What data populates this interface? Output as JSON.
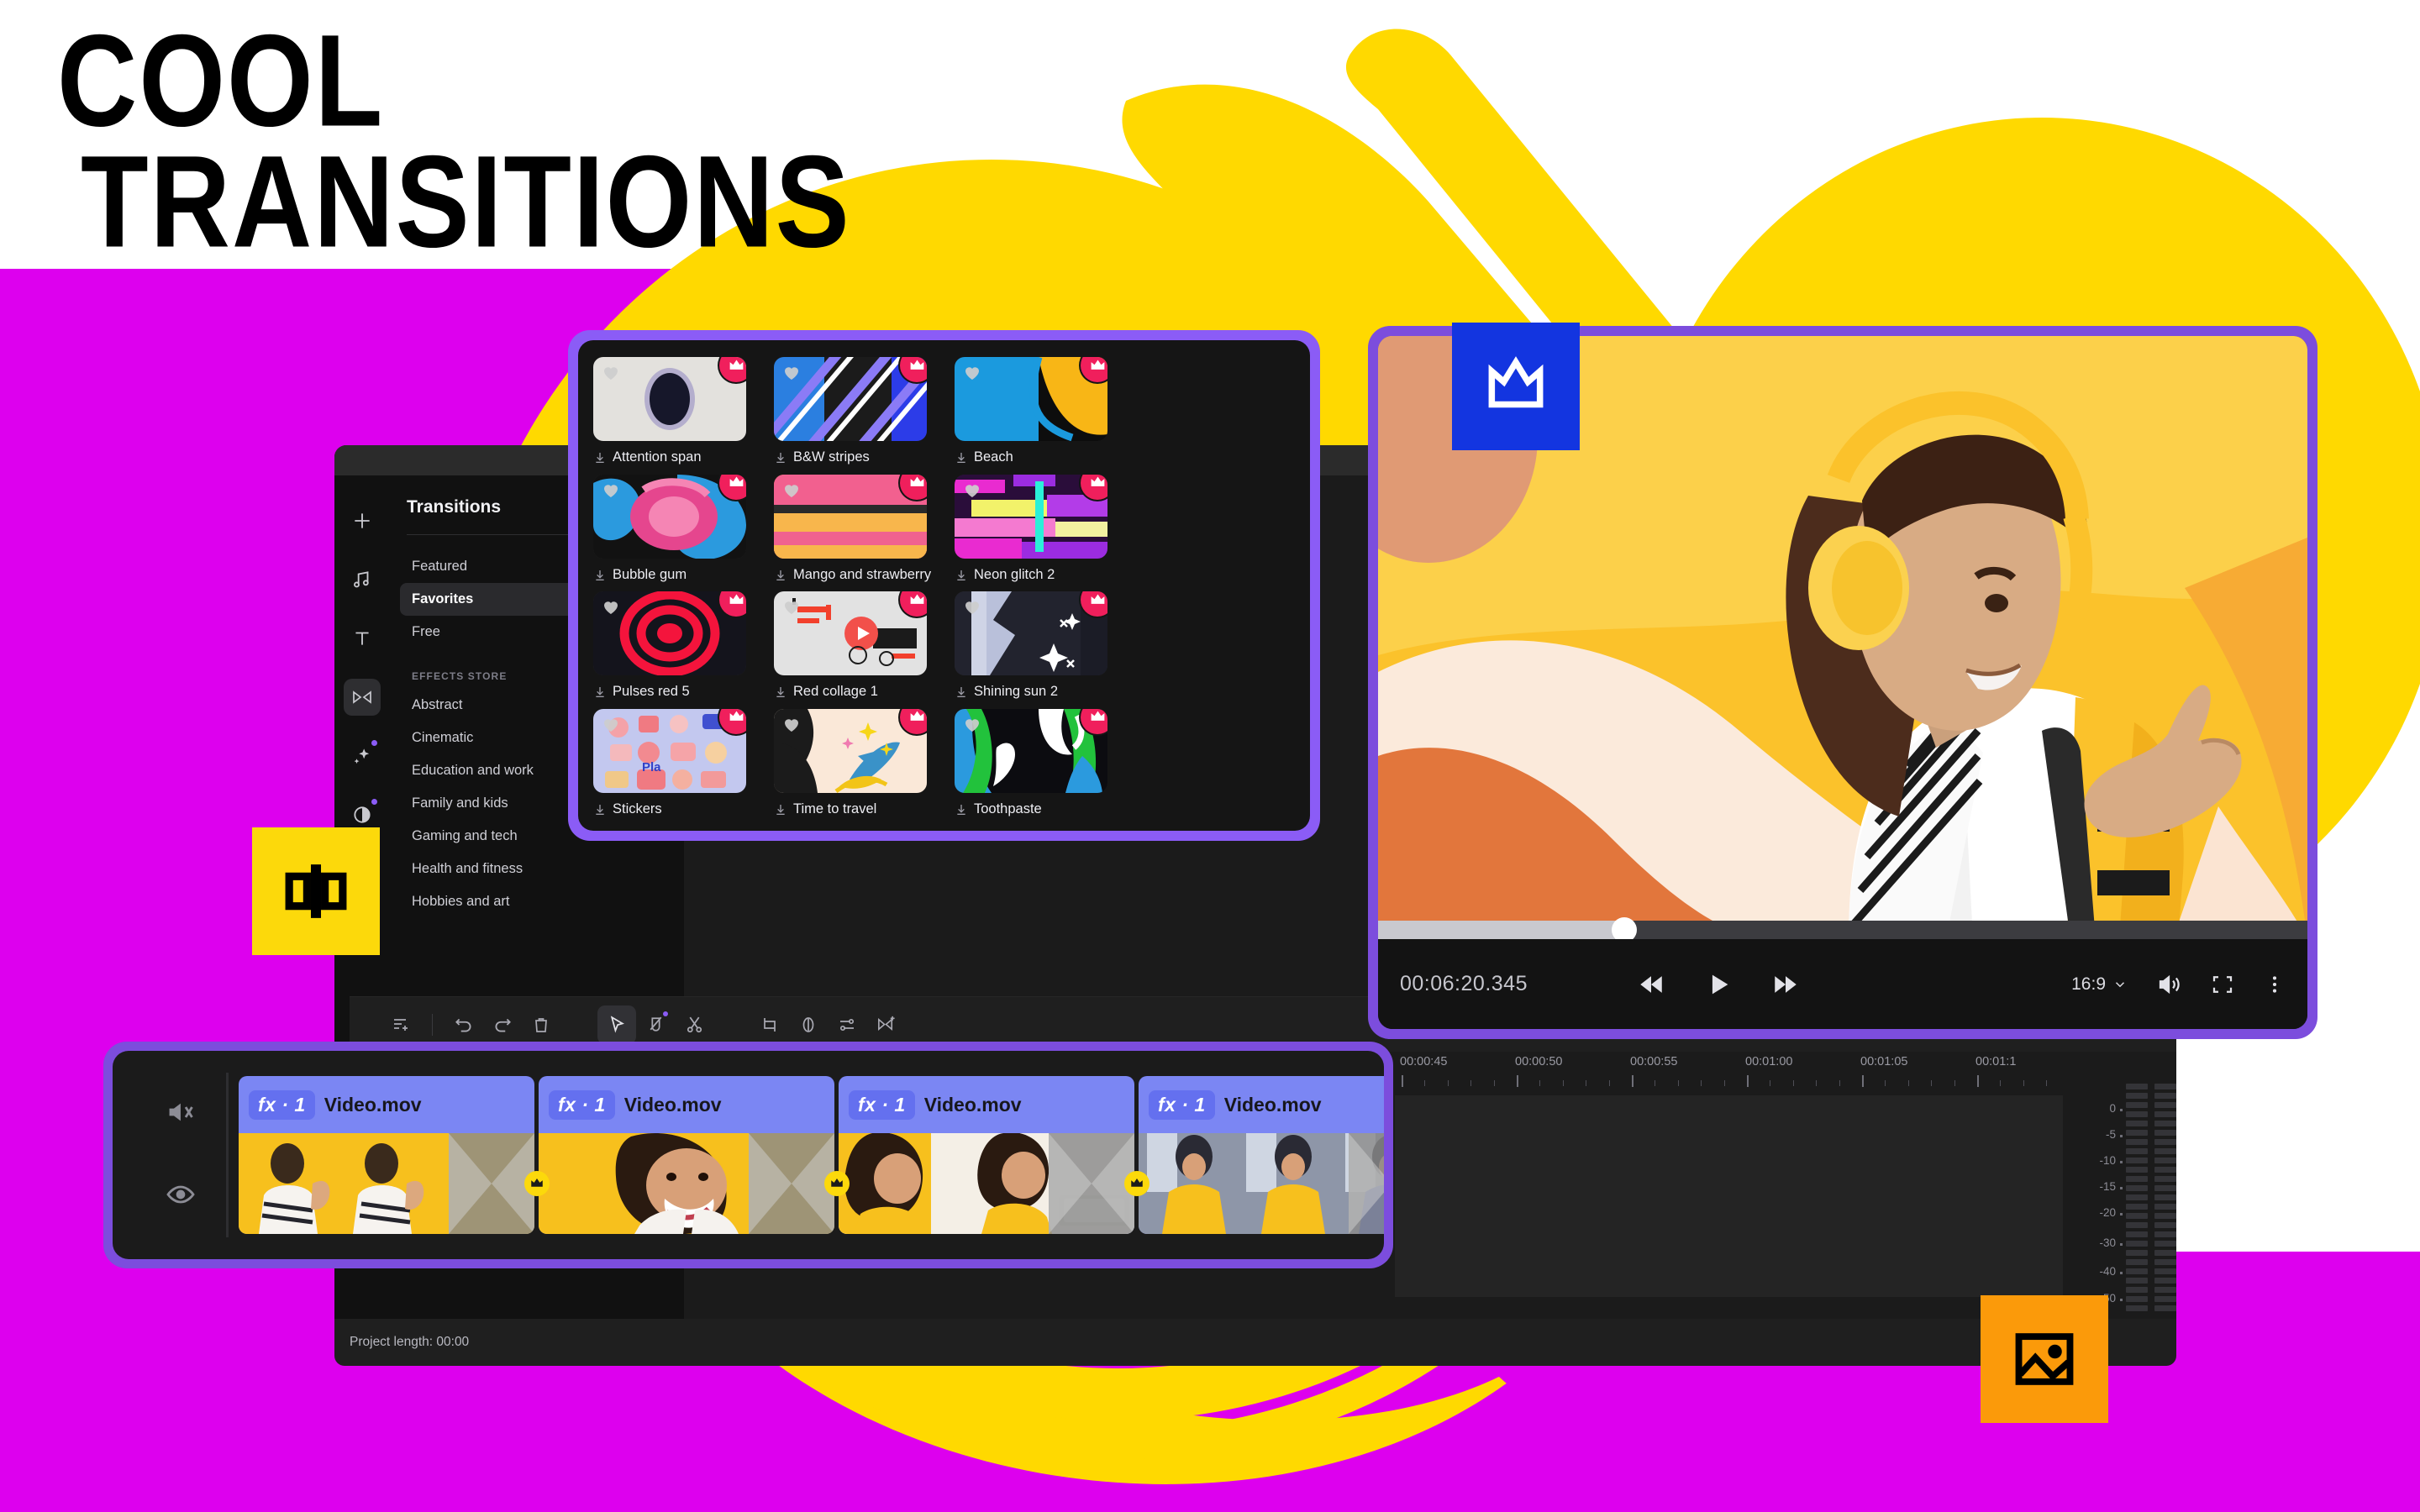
{
  "poster": {
    "headline_line1": "COOL",
    "headline_line2": "TRANSITIONS",
    "colors": {
      "magenta": "#dd00ee",
      "yellow": "#ffd900",
      "purple": "#7c4ddd",
      "blue": "#1335e0",
      "orange": "#fb9a0a",
      "pink_badge": "#f01f5c",
      "clip_blue": "#7b86f3"
    }
  },
  "icon_rail": [
    {
      "name": "add-media",
      "icon": "plus-icon",
      "active": false,
      "dot": false
    },
    {
      "name": "audio",
      "icon": "music-note-icon",
      "active": false,
      "dot": false
    },
    {
      "name": "titles",
      "icon": "text-t-icon",
      "active": false,
      "dot": false
    },
    {
      "name": "transitions",
      "icon": "transition-icon",
      "active": true,
      "dot": false
    },
    {
      "name": "effects",
      "icon": "sparkle-icon",
      "active": false,
      "dot": true
    },
    {
      "name": "filters",
      "icon": "contrast-circle-icon",
      "active": false,
      "dot": true
    },
    {
      "name": "stickers",
      "icon": "sticker-add-icon",
      "active": false,
      "dot": false
    },
    {
      "name": "more-tools",
      "icon": "grid-add-icon",
      "active": false,
      "dot": true
    }
  ],
  "panel": {
    "title": "Transitions",
    "nav": [
      {
        "label": "Featured",
        "active": false
      },
      {
        "label": "Favorites",
        "active": true
      },
      {
        "label": "Free",
        "active": false
      }
    ],
    "group_label": "EFFECTS STORE",
    "store_items": [
      {
        "label": "Abstract"
      },
      {
        "label": "Cinematic"
      },
      {
        "label": "Education and work"
      },
      {
        "label": "Family and kids"
      },
      {
        "label": "Gaming and tech"
      },
      {
        "label": "Health and fitness"
      },
      {
        "label": "Hobbies and art"
      }
    ]
  },
  "transitions_grid": [
    {
      "label": "Attention span",
      "premium": true,
      "favorite": true,
      "thumb": "attention-span"
    },
    {
      "label": "B&W stripes",
      "premium": true,
      "favorite": true,
      "thumb": "bw-stripes"
    },
    {
      "label": "Beach",
      "premium": true,
      "favorite": true,
      "thumb": "beach"
    },
    {
      "label": "Bubble gum",
      "premium": true,
      "favorite": true,
      "thumb": "bubble-gum"
    },
    {
      "label": "Mango and strawberry",
      "premium": true,
      "favorite": true,
      "thumb": "mango-strawberry"
    },
    {
      "label": "Neon glitch 2",
      "premium": true,
      "favorite": true,
      "thumb": "neon-glitch"
    },
    {
      "label": "Pulses red 5",
      "premium": true,
      "favorite": true,
      "thumb": "pulses-red"
    },
    {
      "label": "Red collage 1",
      "premium": true,
      "favorite": true,
      "thumb": "red-collage"
    },
    {
      "label": "Shining sun 2",
      "premium": true,
      "favorite": true,
      "thumb": "shining-sun"
    },
    {
      "label": "Stickers",
      "premium": true,
      "favorite": true,
      "thumb": "stickers"
    },
    {
      "label": "Time to travel",
      "premium": true,
      "favorite": true,
      "thumb": "time-to-travel"
    },
    {
      "label": "Toothpaste",
      "premium": true,
      "favorite": true,
      "thumb": "toothpaste"
    }
  ],
  "preview": {
    "timecode": "00:06:20.345",
    "aspect_ratio": "16:9",
    "progress_percent": 26.5,
    "controls": [
      {
        "name": "rewind-button",
        "icon": "rewind-icon"
      },
      {
        "name": "play-button",
        "icon": "play-icon"
      },
      {
        "name": "fast-forward-button",
        "icon": "fast-forward-icon"
      }
    ],
    "right_controls": [
      {
        "name": "volume-button",
        "icon": "speaker-icon"
      },
      {
        "name": "fullscreen-button",
        "icon": "fullscreen-icon"
      },
      {
        "name": "more-options-button",
        "icon": "kebab-menu-icon"
      }
    ]
  },
  "timeline_toolbar": [
    {
      "name": "add-track-button",
      "icon": "add-track-icon",
      "active": false,
      "dot": false
    },
    {
      "name": "separator-1",
      "icon": "divider",
      "active": false,
      "dot": false
    },
    {
      "name": "undo-button",
      "icon": "undo-icon",
      "active": false,
      "dot": false
    },
    {
      "name": "redo-button",
      "icon": "redo-icon",
      "active": false,
      "dot": false
    },
    {
      "name": "delete-button",
      "icon": "trash-icon",
      "active": false,
      "dot": false
    },
    {
      "name": "gap-1",
      "icon": "gap",
      "active": false,
      "dot": false
    },
    {
      "name": "select-tool",
      "icon": "cursor-arrow-icon",
      "active": true,
      "dot": false
    },
    {
      "name": "marker-tool",
      "icon": "pen-marker-icon",
      "active": false,
      "dot": true
    },
    {
      "name": "split-tool",
      "icon": "scissors-icon",
      "active": false,
      "dot": false
    },
    {
      "name": "gap-2",
      "icon": "gap",
      "active": false,
      "dot": false
    },
    {
      "name": "crop-button",
      "icon": "crop-icon",
      "active": false,
      "dot": false
    },
    {
      "name": "color-button",
      "icon": "contrast-icon",
      "active": false,
      "dot": false
    },
    {
      "name": "adjust-button",
      "icon": "sliders-icon",
      "active": false,
      "dot": false
    },
    {
      "name": "transition-button",
      "icon": "transition-add-icon",
      "active": false,
      "dot": false
    }
  ],
  "ruler": {
    "labels": [
      "00:00:45",
      "00:00:50",
      "00:00:55",
      "00:01:00",
      "00:01:05",
      "00:01:1"
    ]
  },
  "audio_meter": {
    "scale": [
      "0",
      "-5",
      "-10",
      "-15",
      "-20",
      "-30",
      "-40",
      "-50"
    ]
  },
  "track_head": [
    {
      "name": "mute-track-toggle",
      "icon": "speaker-muted-icon"
    },
    {
      "name": "hide-track-toggle",
      "icon": "eye-icon"
    }
  ],
  "clips": [
    {
      "fx_label": "fx · 1",
      "name": "Video.mov"
    },
    {
      "fx_label": "fx · 1",
      "name": "Video.mov"
    },
    {
      "fx_label": "fx · 1",
      "name": "Video.mov"
    },
    {
      "fx_label": "fx · 1",
      "name": "Video.mov"
    }
  ],
  "transition_markers": 3,
  "project_bar": {
    "label": "Project length: 00:00"
  },
  "floating_badges": [
    {
      "name": "crown-badge",
      "icon": "crown-icon",
      "color": "#1335e0"
    },
    {
      "name": "transition-badge",
      "icon": "transition-icon",
      "color": "#fcd90b"
    },
    {
      "name": "image-badge",
      "icon": "image-icon",
      "color": "#fb9a0a"
    }
  ]
}
